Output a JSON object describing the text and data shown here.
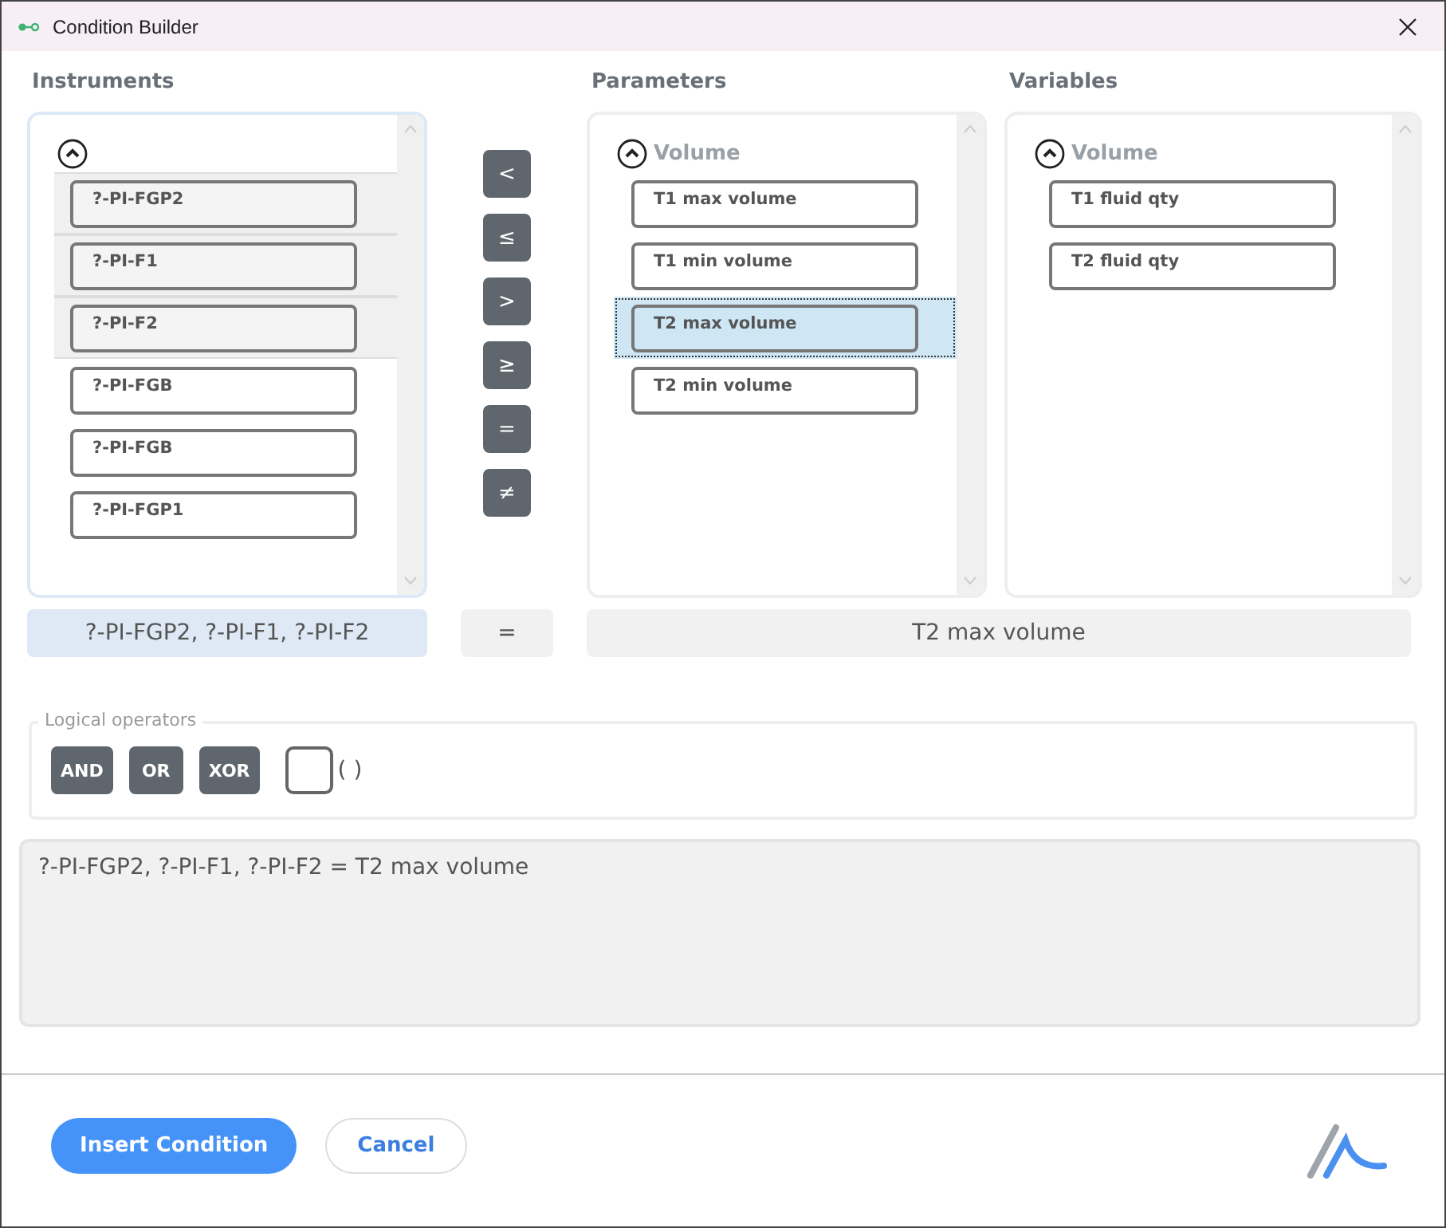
{
  "window": {
    "title": "Condition Builder"
  },
  "instruments": {
    "heading": "Instruments",
    "expanded": true,
    "items": [
      {
        "label": "?-PI-FGP2",
        "selected": true
      },
      {
        "label": "?-PI-F1",
        "selected": true
      },
      {
        "label": "?-PI-F2",
        "selected": true
      },
      {
        "label": "?-PI-FGB",
        "selected": false
      },
      {
        "label": "?-PI-FGB",
        "selected": false
      },
      {
        "label": "?-PI-FGP1",
        "selected": false
      }
    ]
  },
  "operators": [
    "<",
    "≤",
    ">",
    "≥",
    "=",
    "≠"
  ],
  "parameters": {
    "heading": "Parameters",
    "group": "Volume",
    "expanded": true,
    "items": [
      {
        "label": "T1 max volume",
        "selected": false
      },
      {
        "label": "T1 min volume",
        "selected": false
      },
      {
        "label": "T2 max volume",
        "selected": true
      },
      {
        "label": "T2 min volume",
        "selected": false
      }
    ]
  },
  "variables": {
    "heading": "Variables",
    "group": "Volume",
    "expanded": true,
    "items": [
      {
        "label": "T1 fluid qty",
        "selected": false
      },
      {
        "label": "T2 fluid qty",
        "selected": false
      }
    ]
  },
  "summary": {
    "left": "?-PI-FGP2, ?-PI-F1, ?-PI-F2",
    "operator": "=",
    "right": "T2 max volume"
  },
  "logical_operators": {
    "legend": "Logical operators",
    "buttons": [
      "AND",
      "OR",
      "XOR"
    ],
    "parentheses": {
      "label": "( )",
      "checked": false
    }
  },
  "expression": "?-PI-FGP2, ?-PI-F1, ?-PI-F2 = T2 max volume",
  "footer": {
    "primary": "Insert Condition",
    "secondary": "Cancel"
  }
}
